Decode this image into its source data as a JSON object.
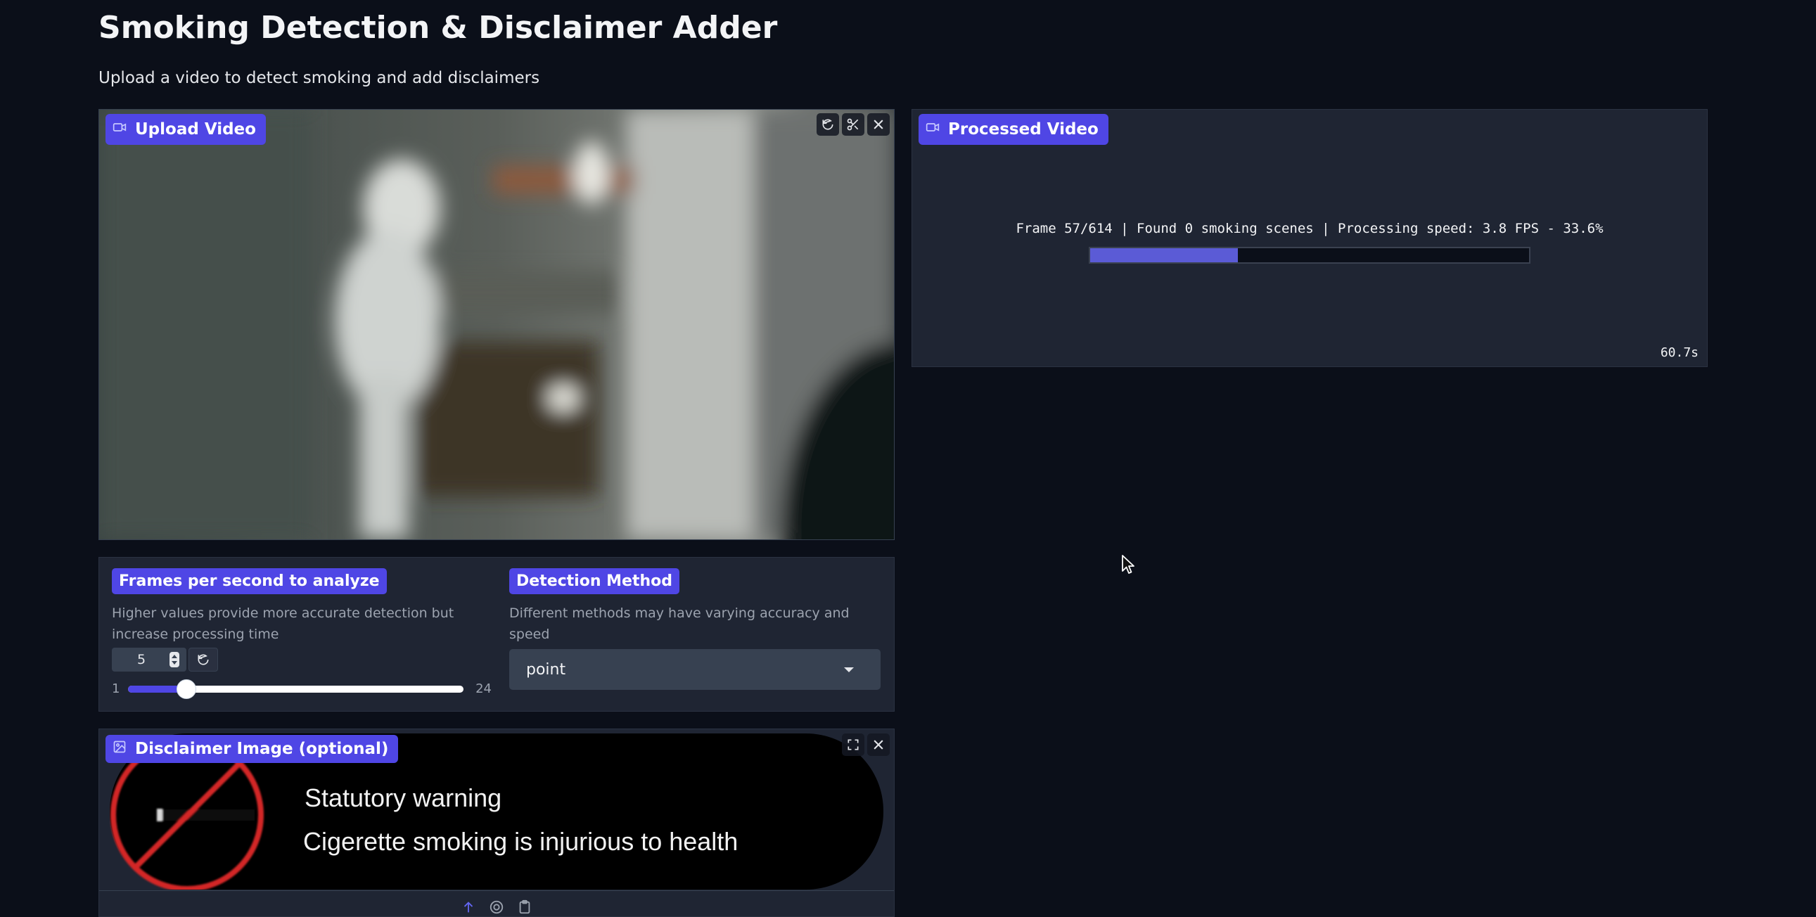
{
  "page": {
    "title": "Smoking Detection & Disclaimer Adder",
    "subtitle": "Upload a video to detect smoking and add disclaimers"
  },
  "upload_video": {
    "label": "Upload Video",
    "icon": "video-camera-icon",
    "tools": [
      "undo-icon",
      "scissors-icon",
      "close-icon"
    ]
  },
  "processed_video": {
    "label": "Processed Video",
    "icon": "video-camera-icon",
    "status": "Frame 57/614 | Found 0 smoking scenes | Processing speed: 3.8 FPS - 33.6%",
    "progress_percent": 33.6,
    "elapsed": "60.7s"
  },
  "fps_setting": {
    "label": "Frames per second to analyze",
    "info": "Higher values provide more accurate detection but increase processing time",
    "value": "5",
    "min": "1",
    "max": "24",
    "value_num": 5,
    "min_num": 1,
    "max_num": 24
  },
  "detection_method": {
    "label": "Detection Method",
    "info": "Different methods may have varying accuracy and speed",
    "selected": "point"
  },
  "disclaimer_image": {
    "label": "Disclaimer Image (optional)",
    "icon": "image-icon",
    "tools": [
      "fullscreen-icon",
      "close-icon"
    ],
    "text_line1": "Statutory warning",
    "text_line2": "Cigerette smoking is injurious to health",
    "footer_icons": [
      "upload-icon",
      "webcam-icon",
      "clipboard-icon"
    ]
  },
  "colors": {
    "background": "#0b0f19",
    "panel": "#1f2533",
    "accent": "#4f46e5",
    "progress_fill": "#5b5bd6"
  }
}
